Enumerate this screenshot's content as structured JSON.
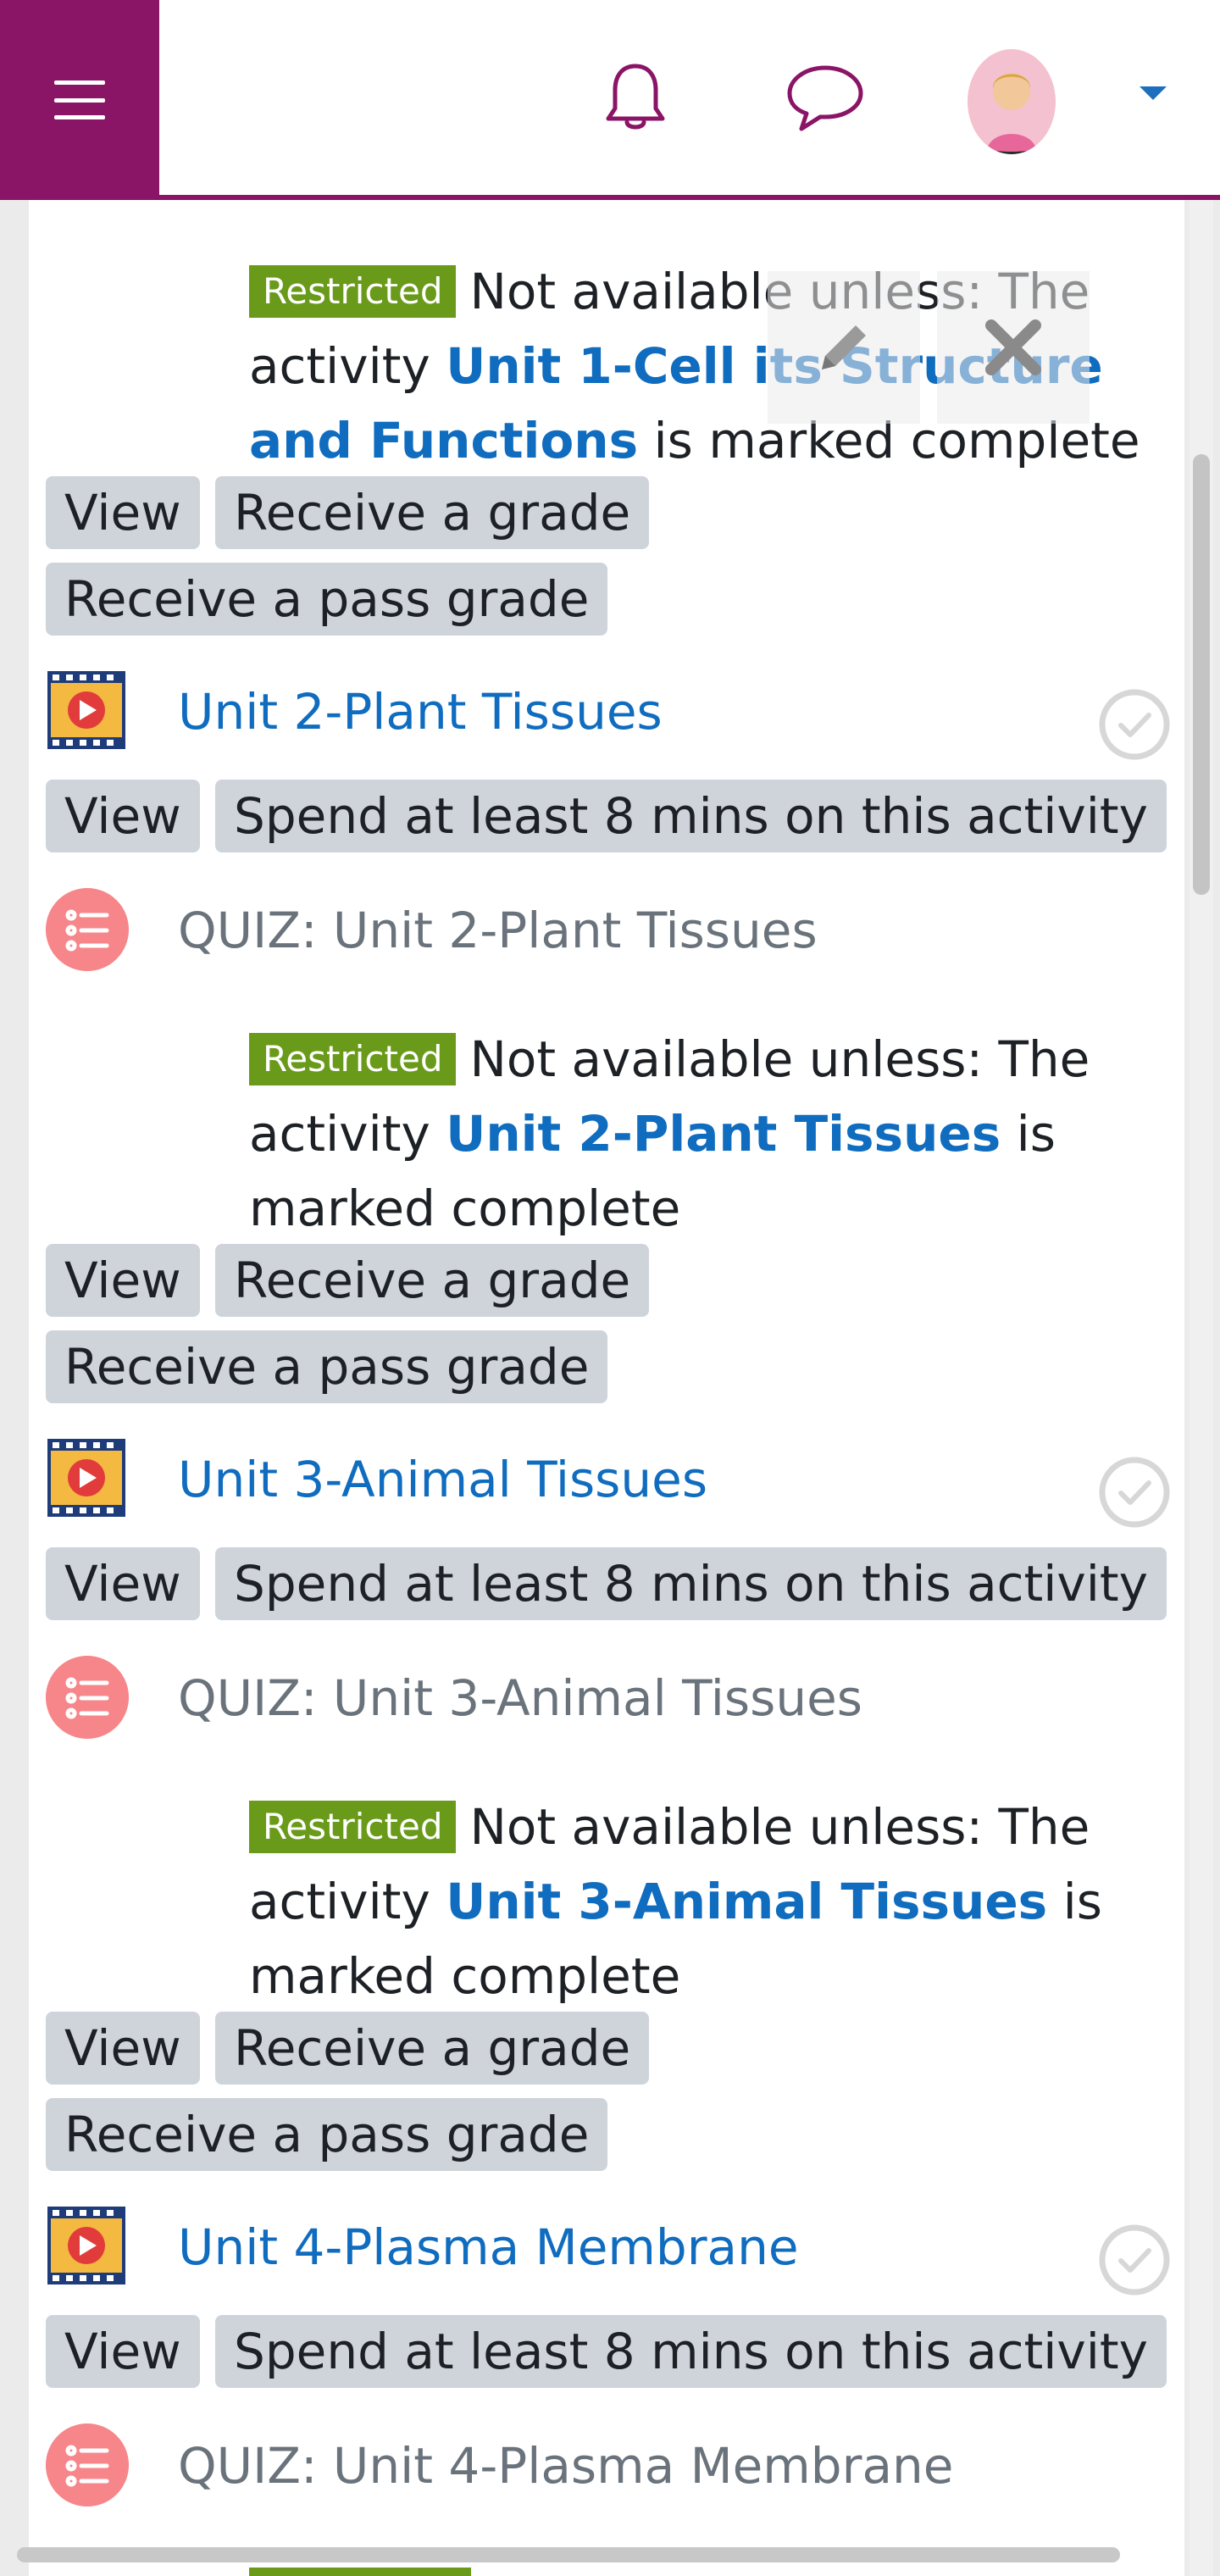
{
  "nav": {
    "menu_icon": "hamburger-icon",
    "notifications_icon": "bell-icon",
    "messages_icon": "chat-bubble-icon",
    "user_menu_icon": "caret-down-icon"
  },
  "colors": {
    "brand": "#8a1466",
    "link": "#0f6cbf",
    "badge": "#6a9a1a",
    "chip": "#ced4da"
  },
  "restrictions": [
    {
      "badge": "Restricted",
      "text_before": "Not available unless: The activity ",
      "link": "Unit 1-Cell its Structure and Functions",
      "text_after": " is marked complete"
    },
    {
      "badge": "Restricted",
      "text_before": "Not available unless: The activity ",
      "link": "Unit 2-Plant Tissues",
      "text_after": " is marked complete"
    },
    {
      "badge": "Restricted",
      "text_before": "Not available unless: The activity ",
      "link": "Unit 3-Animal Tissues",
      "text_after": " is marked complete"
    }
  ],
  "conditions": {
    "view": "View",
    "receive_grade": "Receive a grade",
    "receive_pass_grade": "Receive a pass grade",
    "spend_time": "Spend at least 8 mins on this activity"
  },
  "activities": [
    {
      "title": "Unit 2-Plant Tissues",
      "icon": "video-icon"
    },
    {
      "title": "Unit 3-Animal Tissues",
      "icon": "video-icon"
    },
    {
      "title": "Unit 4-Plasma Membrane",
      "icon": "video-icon"
    }
  ],
  "quizzes": [
    {
      "title": "QUIZ: Unit 2-Plant Tissues",
      "icon": "quiz-list-icon"
    },
    {
      "title": "QUIZ: Unit 3-Animal Tissues",
      "icon": "quiz-list-icon"
    },
    {
      "title": "QUIZ: Unit 4-Plasma Membrane",
      "icon": "quiz-list-icon"
    }
  ]
}
